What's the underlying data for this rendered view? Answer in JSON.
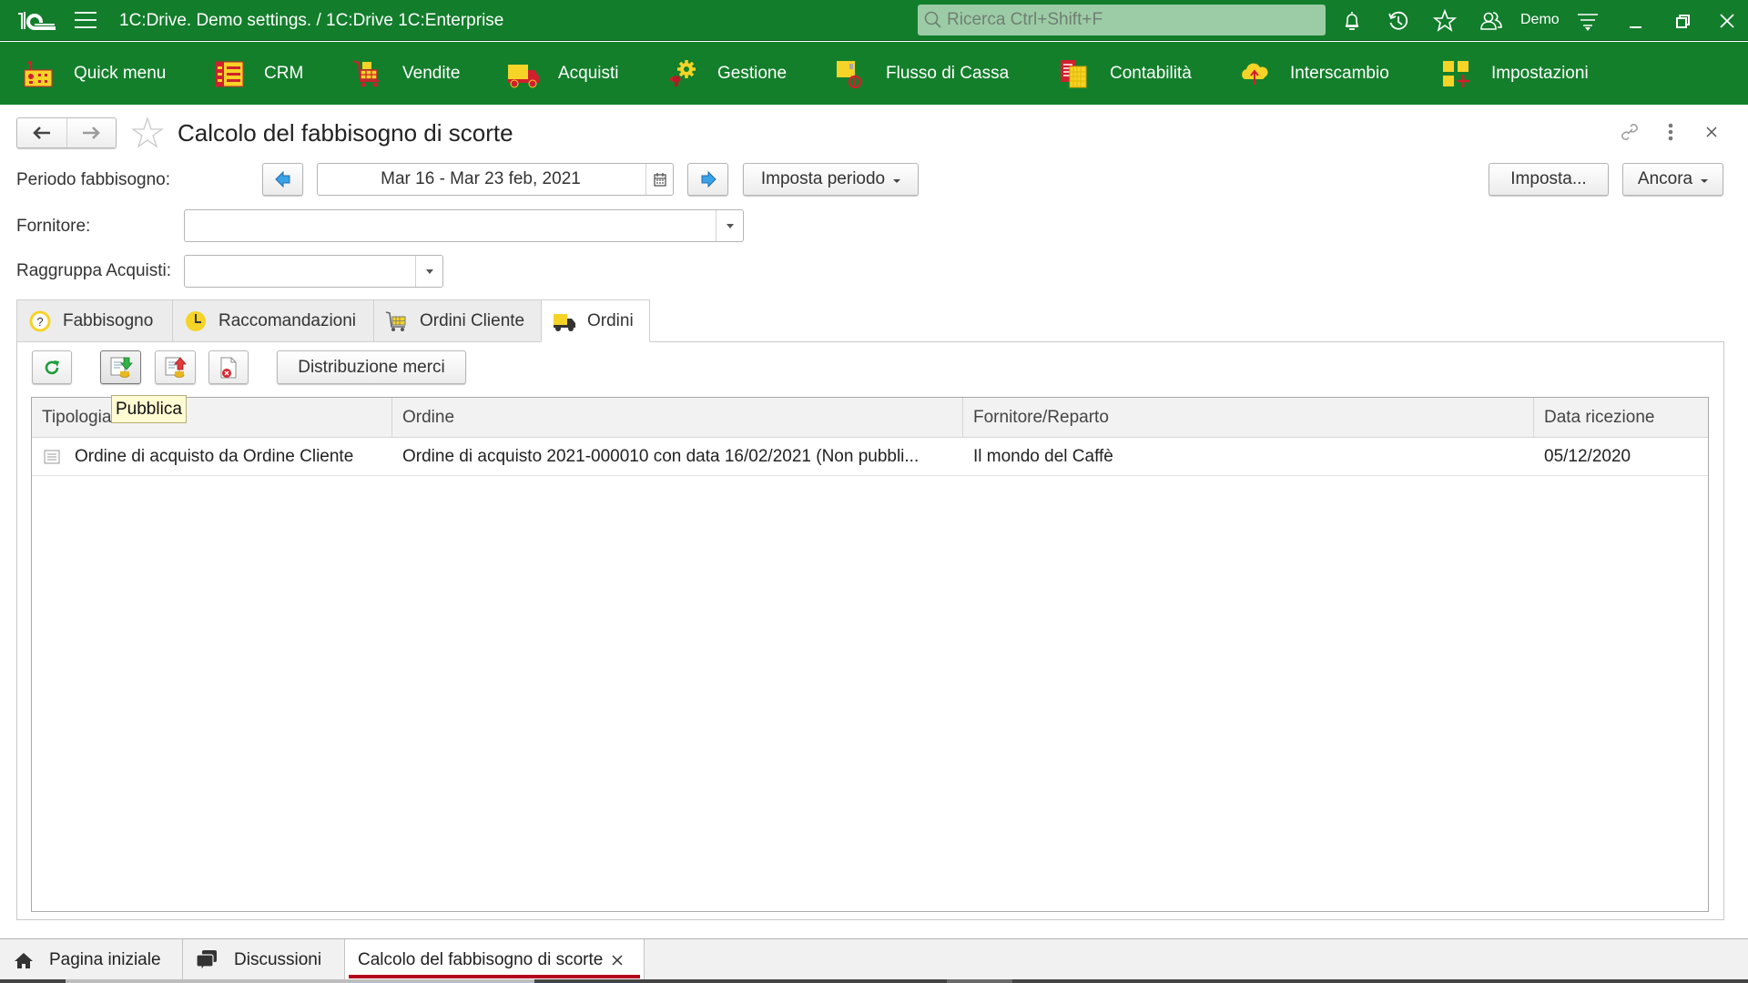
{
  "titlebar": {
    "app_title": "1C:Drive. Demo settings. / 1C:Drive 1C:Enterprise",
    "search_placeholder": "Ricerca Ctrl+Shift+F",
    "user_name": "Demo",
    "icons": [
      "bell-icon",
      "history-icon",
      "star-icon",
      "users-icon",
      "settings-menu-icon",
      "minimize-icon",
      "restore-icon",
      "close-icon"
    ]
  },
  "menu": {
    "items": [
      {
        "label": "Quick menu",
        "icon": "quick-menu-icon"
      },
      {
        "label": "CRM",
        "icon": "crm-icon"
      },
      {
        "label": "Vendite",
        "icon": "cart-icon"
      },
      {
        "label": "Acquisti",
        "icon": "truck-icon"
      },
      {
        "label": "Gestione",
        "icon": "gear-icon"
      },
      {
        "label": "Flusso di Cassa",
        "icon": "cash-flow-icon"
      },
      {
        "label": "Contabilità",
        "icon": "accounting-icon"
      },
      {
        "label": "Interscambio",
        "icon": "cloud-exchange-icon"
      },
      {
        "label": "Impostazioni",
        "icon": "settings-grid-icon"
      }
    ]
  },
  "form": {
    "title": "Calcolo del fabbisogno di scorte",
    "period_label": "Periodo fabbisogno:",
    "period_value": "Mar 16 - Mar 23 feb, 2021",
    "set_period_label": "Imposta periodo",
    "settings_button": "Imposta...",
    "more_button": "Ancora",
    "supplier_label": "Fornitore:",
    "supplier_value": "",
    "group_label": "Raggruppa Acquisti:",
    "group_value": ""
  },
  "tabs": [
    {
      "label": "Fabbisogno",
      "active": false
    },
    {
      "label": "Raccomandazioni",
      "active": false
    },
    {
      "label": "Ordini Cliente",
      "active": false
    },
    {
      "label": "Ordini",
      "active": true
    }
  ],
  "toolbar": {
    "distribute_label": "Distribuzione merci",
    "tooltip": "Pubblica"
  },
  "table": {
    "columns": [
      "Tipologia",
      "Ordine",
      "Fornitore/Reparto",
      "Data ricezione"
    ],
    "rows": [
      [
        "Ordine di acquisto da Ordine Cliente",
        "Ordine di acquisto 2021-000010 con data 16/02/2021 (Non pubbli...",
        "Il mondo del Caffè",
        "05/12/2020"
      ]
    ]
  },
  "bottom_tabs": [
    {
      "label": "Pagina iniziale",
      "active": false
    },
    {
      "label": "Discussioni",
      "active": false
    },
    {
      "label": "Calcolo del fabbisogno di scorte",
      "active": true
    }
  ],
  "colors": {
    "brand_green": "#127d2b",
    "active_tab_underline": "#b5001e",
    "icon_yellow": "#f5d327",
    "icon_red": "#d0202e"
  }
}
